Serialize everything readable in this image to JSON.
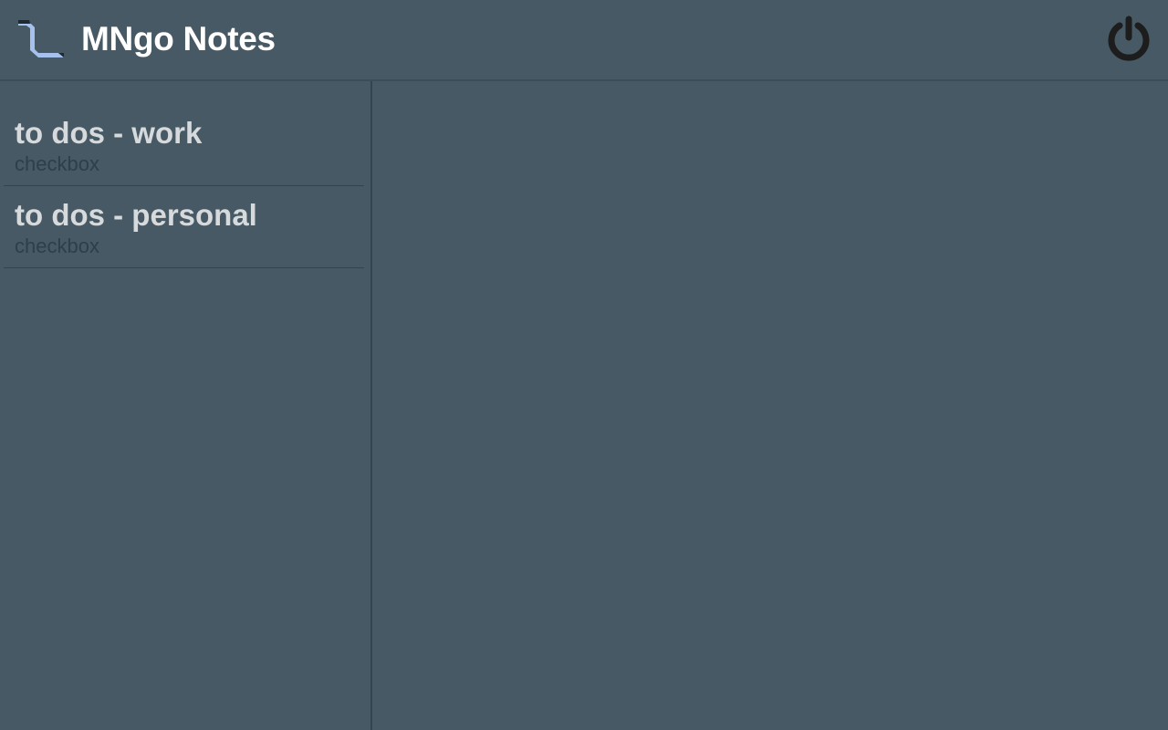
{
  "header": {
    "title": "MNgo Notes",
    "logo_icon": "mngo-logo-icon",
    "power_icon": "power-icon"
  },
  "notes": [
    {
      "title": "to dos - work",
      "type": "checkbox"
    },
    {
      "title": "to dos - personal",
      "type": "checkbox"
    }
  ],
  "colors": {
    "background": "#465964",
    "title_text": "#ffffff",
    "note_title": "#d6dadc",
    "note_subtitle": "#2f3f49",
    "logo_accent": "#a7c1ee",
    "power_icon": "#1d1d1d"
  }
}
